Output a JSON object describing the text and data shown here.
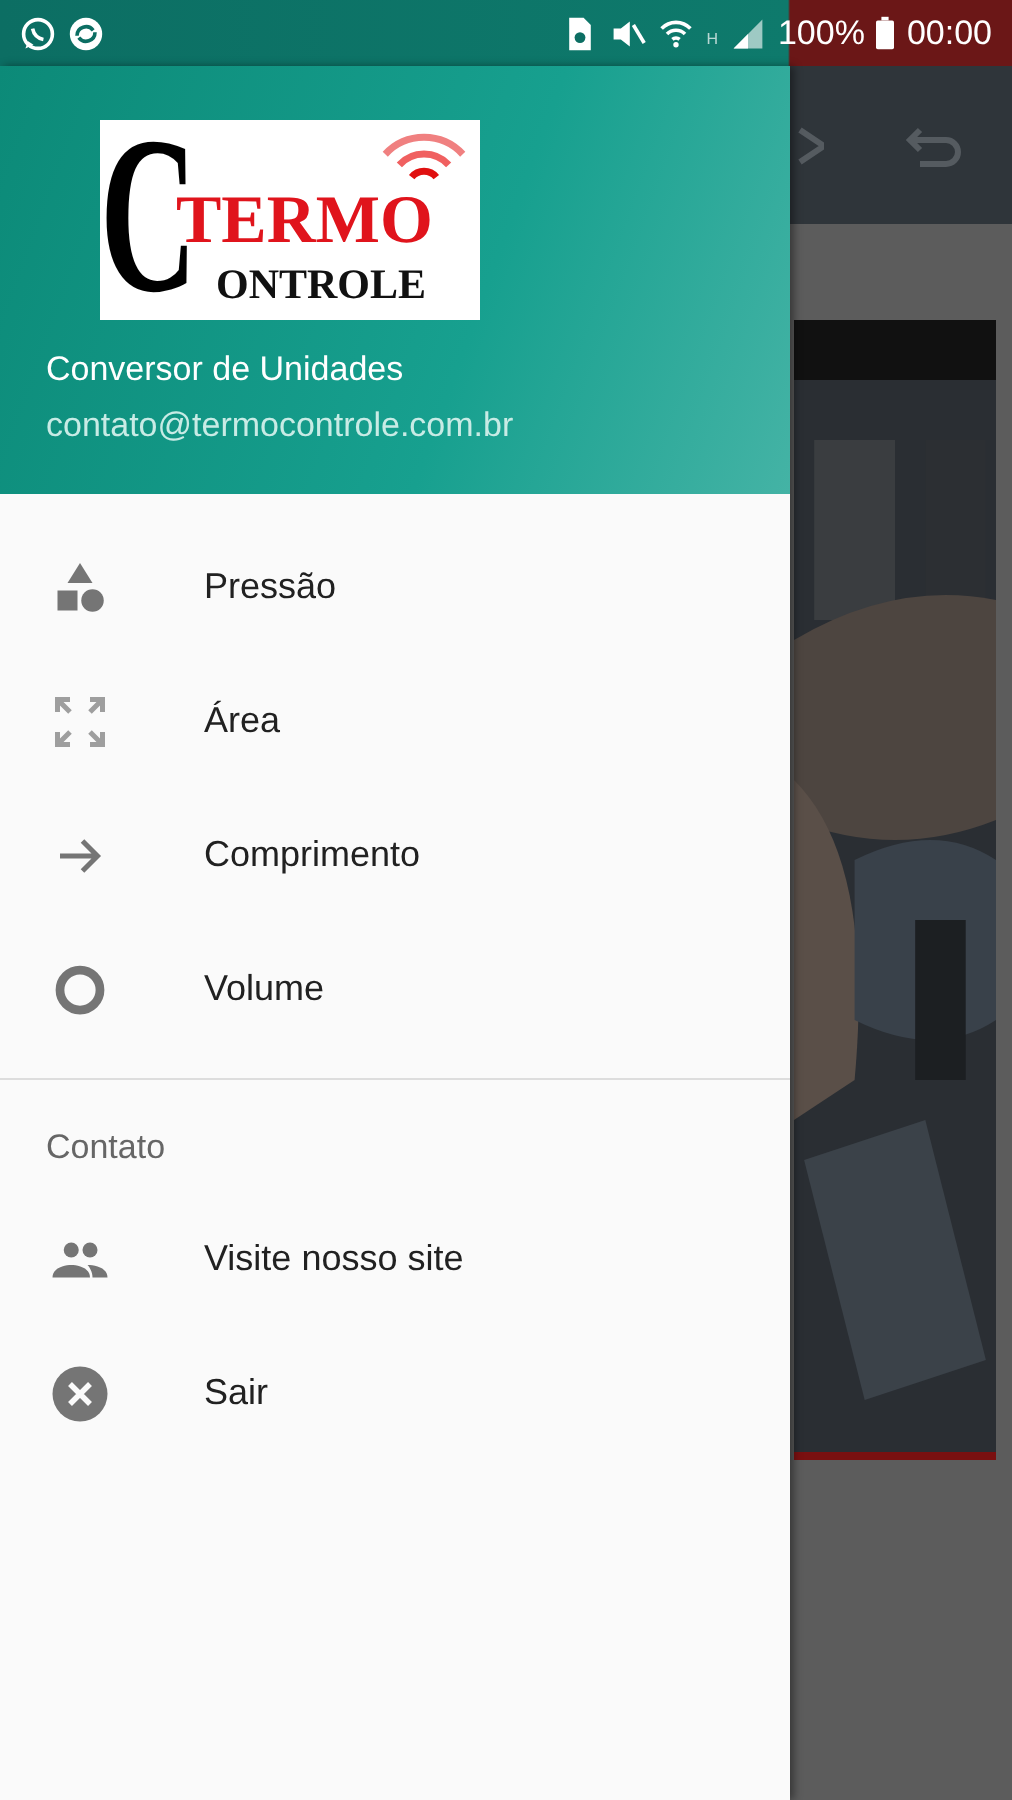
{
  "status_bar": {
    "network": "H",
    "battery": "100%",
    "time": "00:00"
  },
  "drawer": {
    "logo": {
      "initial": "C",
      "top": "TERMO",
      "bottom": "ONTROLE"
    },
    "title": "Conversor de Unidades",
    "email": "contato@termocontrole.com.br",
    "items": [
      {
        "kind": "shapes",
        "label": "Pressão"
      },
      {
        "kind": "expand",
        "label": "Área"
      },
      {
        "kind": "arrow",
        "label": "Comprimento"
      },
      {
        "kind": "ring",
        "label": "Volume"
      }
    ],
    "section": {
      "title": "Contato",
      "items": [
        {
          "kind": "people",
          "label": "Visite nosso site"
        },
        {
          "kind": "cancel",
          "label": "Sair"
        }
      ]
    }
  }
}
